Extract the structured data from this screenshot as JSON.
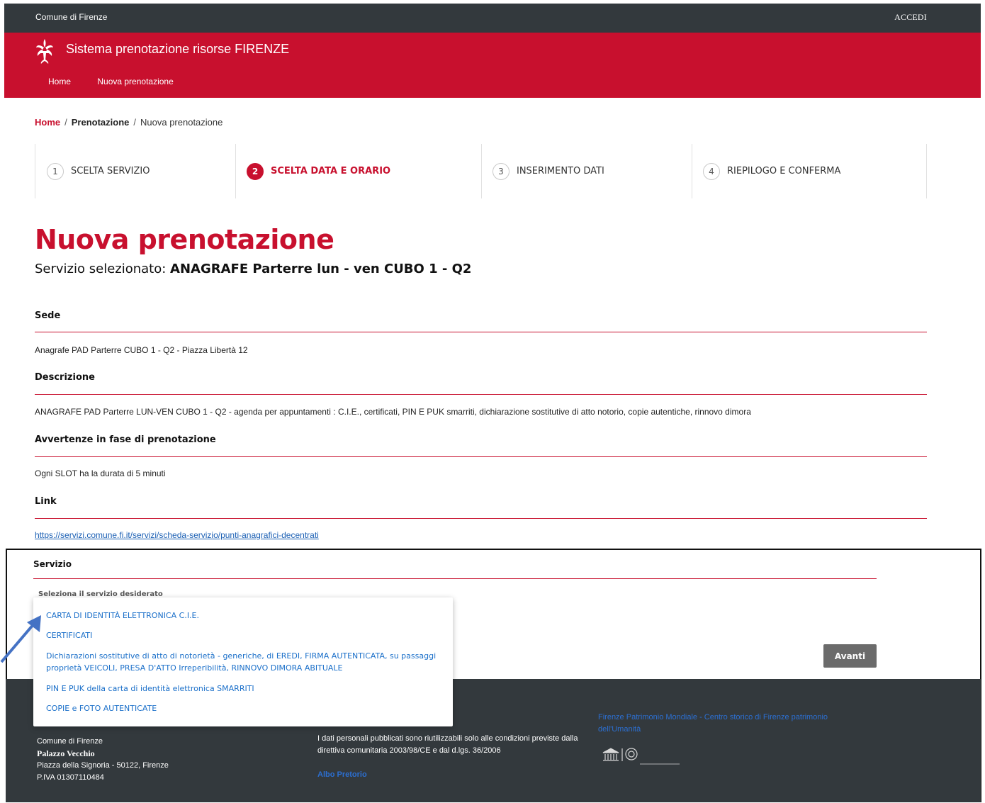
{
  "topbar": {
    "org": "Comune di Firenze",
    "login": "ACCEDI"
  },
  "header": {
    "title": "Sistema prenotazione risorse FIRENZE",
    "nav": [
      "Home",
      "Nuova prenotazione"
    ]
  },
  "breadcrumb": {
    "home": "Home",
    "section": "Prenotazione",
    "current": "Nuova prenotazione"
  },
  "steps": [
    {
      "num": "1",
      "label": "SCELTA SERVIZIO",
      "active": false
    },
    {
      "num": "2",
      "label": "SCELTA DATA E ORARIO",
      "active": true
    },
    {
      "num": "3",
      "label": "INSERIMENTO DATI",
      "active": false
    },
    {
      "num": "4",
      "label": "RIEPILOGO E CONFERMA",
      "active": false
    }
  ],
  "page": {
    "title": "Nuova prenotazione",
    "selected_prefix": "Servizio selezionato: ",
    "selected_value": "ANAGRAFE Parterre lun - ven CUBO 1 - Q2"
  },
  "sections": {
    "sede": {
      "title": "Sede",
      "text": "Anagrafe PAD Parterre CUBO 1 - Q2 - Piazza Libertà 12"
    },
    "descrizione": {
      "title": "Descrizione",
      "text": "ANAGRAFE PAD Parterre LUN-VEN CUBO 1 - Q2 - agenda per appuntamenti : C.I.E., certificati, PIN E PUK smarriti, dichiarazione sostitutive di atto notorio, copie autentiche, rinnovo dimora"
    },
    "avvertenze": {
      "title": "Avvertenze in fase di prenotazione",
      "text": "Ogni SLOT ha la durata di 5 minuti"
    },
    "link": {
      "title": "Link",
      "text": "https://servizi.comune.fi.it/servizi/scheda-servizio/punti-anagrafici-decentrati"
    }
  },
  "servizio": {
    "title": "Servizio",
    "label": "Seleziona il servizio desiderato",
    "options": [
      "CARTA DI IDENTITÀ ELETTRONICA C.I.E.",
      "CERTIFICATI",
      "Dichiarazioni sostitutive di atto di notorietà - generiche, di EREDI, FIRMA AUTENTICATA, su passaggi proprietà VEICOLI, PRESA D'ATTO Irreperibilità, RINNOVO DIMORA ABITUALE",
      "PIN E PUK della carta di identità elettronica SMARRITI",
      "COPIE e FOTO AUTENTICATE"
    ],
    "next_button": "Avanti"
  },
  "footer": {
    "org": "Comune di Firenze",
    "building": "Palazzo Vecchio",
    "address": "Piazza della Signoria - 50122, Firenze",
    "vat": "P.IVA 01307110484",
    "privacy": "I dati personali pubblicati sono riutilizzabili solo alle condizioni previste dalla direttiva comunitaria 2003/98/CE e dal d.lgs. 36/2006",
    "albo": "Albo Pretorio",
    "unesco_link": "Firenze Patrimonio Mondiale - Centro storico di Firenze patrimonio dell'Umanità"
  },
  "colors": {
    "brand_red": "#c8102e",
    "dark_bar": "#33393d",
    "link_blue": "#1a6fc9"
  }
}
